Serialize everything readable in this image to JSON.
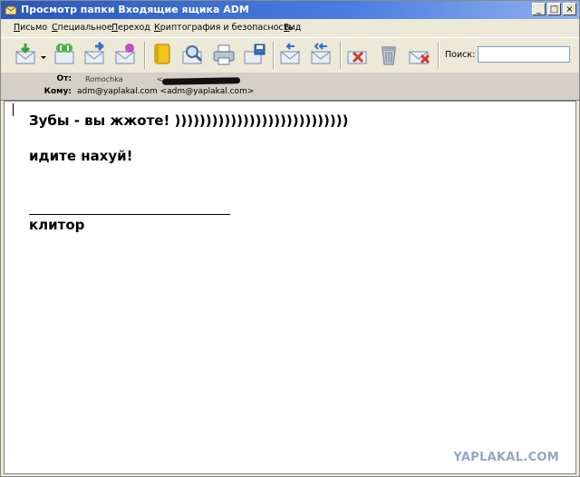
{
  "window": {
    "title": "Просмотр папки Входящие ящика ADM",
    "minimize": "_",
    "maximize": "□",
    "close": "×"
  },
  "menu": [
    "Письмо",
    "Специальное",
    "Переход",
    "Криптография и безопасность",
    "Вид"
  ],
  "toolbar": {
    "icons": [
      "receive-mail-icon",
      "dropdown-arrow-icon",
      "receive-all-icon",
      "forward-mail-icon",
      "new-mail-icon",
      "address-book-icon",
      "find-icon",
      "print-icon",
      "save-icon",
      "reply-icon",
      "reply-all-icon",
      "delete-icon",
      "trash-icon",
      "junk-icon"
    ],
    "search_label": "Поиск:",
    "search_value": ""
  },
  "header": {
    "from_label": "От:",
    "from_name": "Romochka",
    "from_addr": "<",
    "to_label": "Кому:",
    "to_value": "adm@yaplakal.com <adm@yaplakal.com>"
  },
  "message": {
    "line1": "Зубы - вы жжоте! ))))))))))))))))))))))))))))",
    "line2": "идите нахуй!",
    "line3": "клитор"
  },
  "watermark": "YAPLAKAL.COM"
}
